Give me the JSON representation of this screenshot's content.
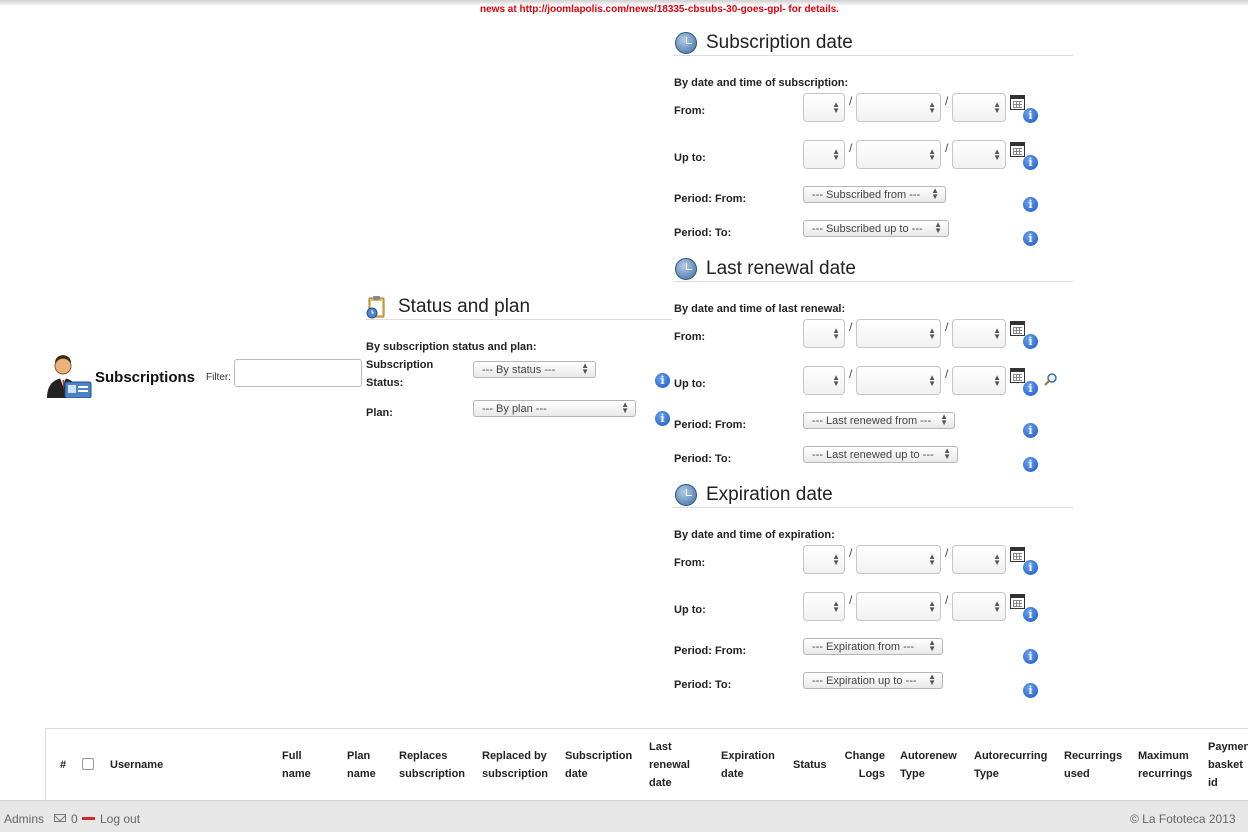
{
  "notice": "news at http://joomlapolis.com/news/18335-cbsubs-30-goes-gpl- for details.",
  "header": {
    "title": "Subscriptions",
    "filter_label": "Filter:",
    "filter_value": ""
  },
  "status_plan": {
    "title": "Status and plan",
    "subtitle": "By subscription status and plan:",
    "status_label_1": "Subscription",
    "status_label_2": "Status:",
    "status_select": "--- By status ---",
    "plan_label": "Plan:",
    "plan_select": "--- By plan ---"
  },
  "subscription_date": {
    "title": "Subscription date",
    "subtitle": "By date and time of subscription:",
    "from_label": "From:",
    "upto_label": "Up to:",
    "period_from_label": "Period: From:",
    "period_to_label": "Period: To:",
    "period_from_select": "--- Subscribed from ---",
    "period_to_select": "--- Subscribed up to ---"
  },
  "last_renewal_date": {
    "title": "Last renewal date",
    "subtitle": "By date and time of last renewal:",
    "from_label": "From:",
    "upto_label": "Up to:",
    "period_from_label": "Period: From:",
    "period_to_label": "Period: To:",
    "period_from_select": "--- Last renewed from ---",
    "period_to_select": "--- Last renewed up to ---"
  },
  "expiration_date": {
    "title": "Expiration date",
    "subtitle": "By date and time of expiration:",
    "from_label": "From:",
    "upto_label": "Up to:",
    "period_from_label": "Period: From:",
    "period_to_label": "Period: To:",
    "period_from_select": "--- Expiration from ---",
    "period_to_select": "--- Expiration up to ---"
  },
  "separator": "/",
  "info_glyph": "i",
  "table": {
    "columns": {
      "num": "#",
      "username": "Username",
      "full_name_1": "Full",
      "full_name_2": "name",
      "plan_name_1": "Plan",
      "plan_name_2": "name",
      "replaces_1": "Replaces",
      "replaces_2": "subscription",
      "replaced_by_1": "Replaced by",
      "replaced_by_2": "subscription",
      "sub_date_1": "Subscription",
      "sub_date_2": "date",
      "last_renewal_1": "Last",
      "last_renewal_2": "renewal",
      "last_renewal_3": "date",
      "expiration_1": "Expiration",
      "expiration_2": "date",
      "status": "Status",
      "change_logs_1": "Change",
      "change_logs_2": "Logs",
      "autorenew_1": "Autorenew",
      "autorenew_2": "Type",
      "autorecurring_1": "Autorecurring",
      "autorecurring_2": "Type",
      "recurrings_used_1": "Recurrings",
      "recurrings_used_2": "used",
      "max_recurrings_1": "Maximum",
      "max_recurrings_2": "recurrings",
      "payment_basket_1": "Paymen",
      "payment_basket_2": "basket",
      "payment_basket_3": "id"
    }
  },
  "footer": {
    "admins": "Admins",
    "messages_count": "0",
    "logout": "Log out",
    "copyright": "© La Fototeca 2013"
  },
  "colors": {
    "notice": "#e0000f",
    "info_blue": "#1651c3",
    "logout_bar": "#d9262b"
  }
}
